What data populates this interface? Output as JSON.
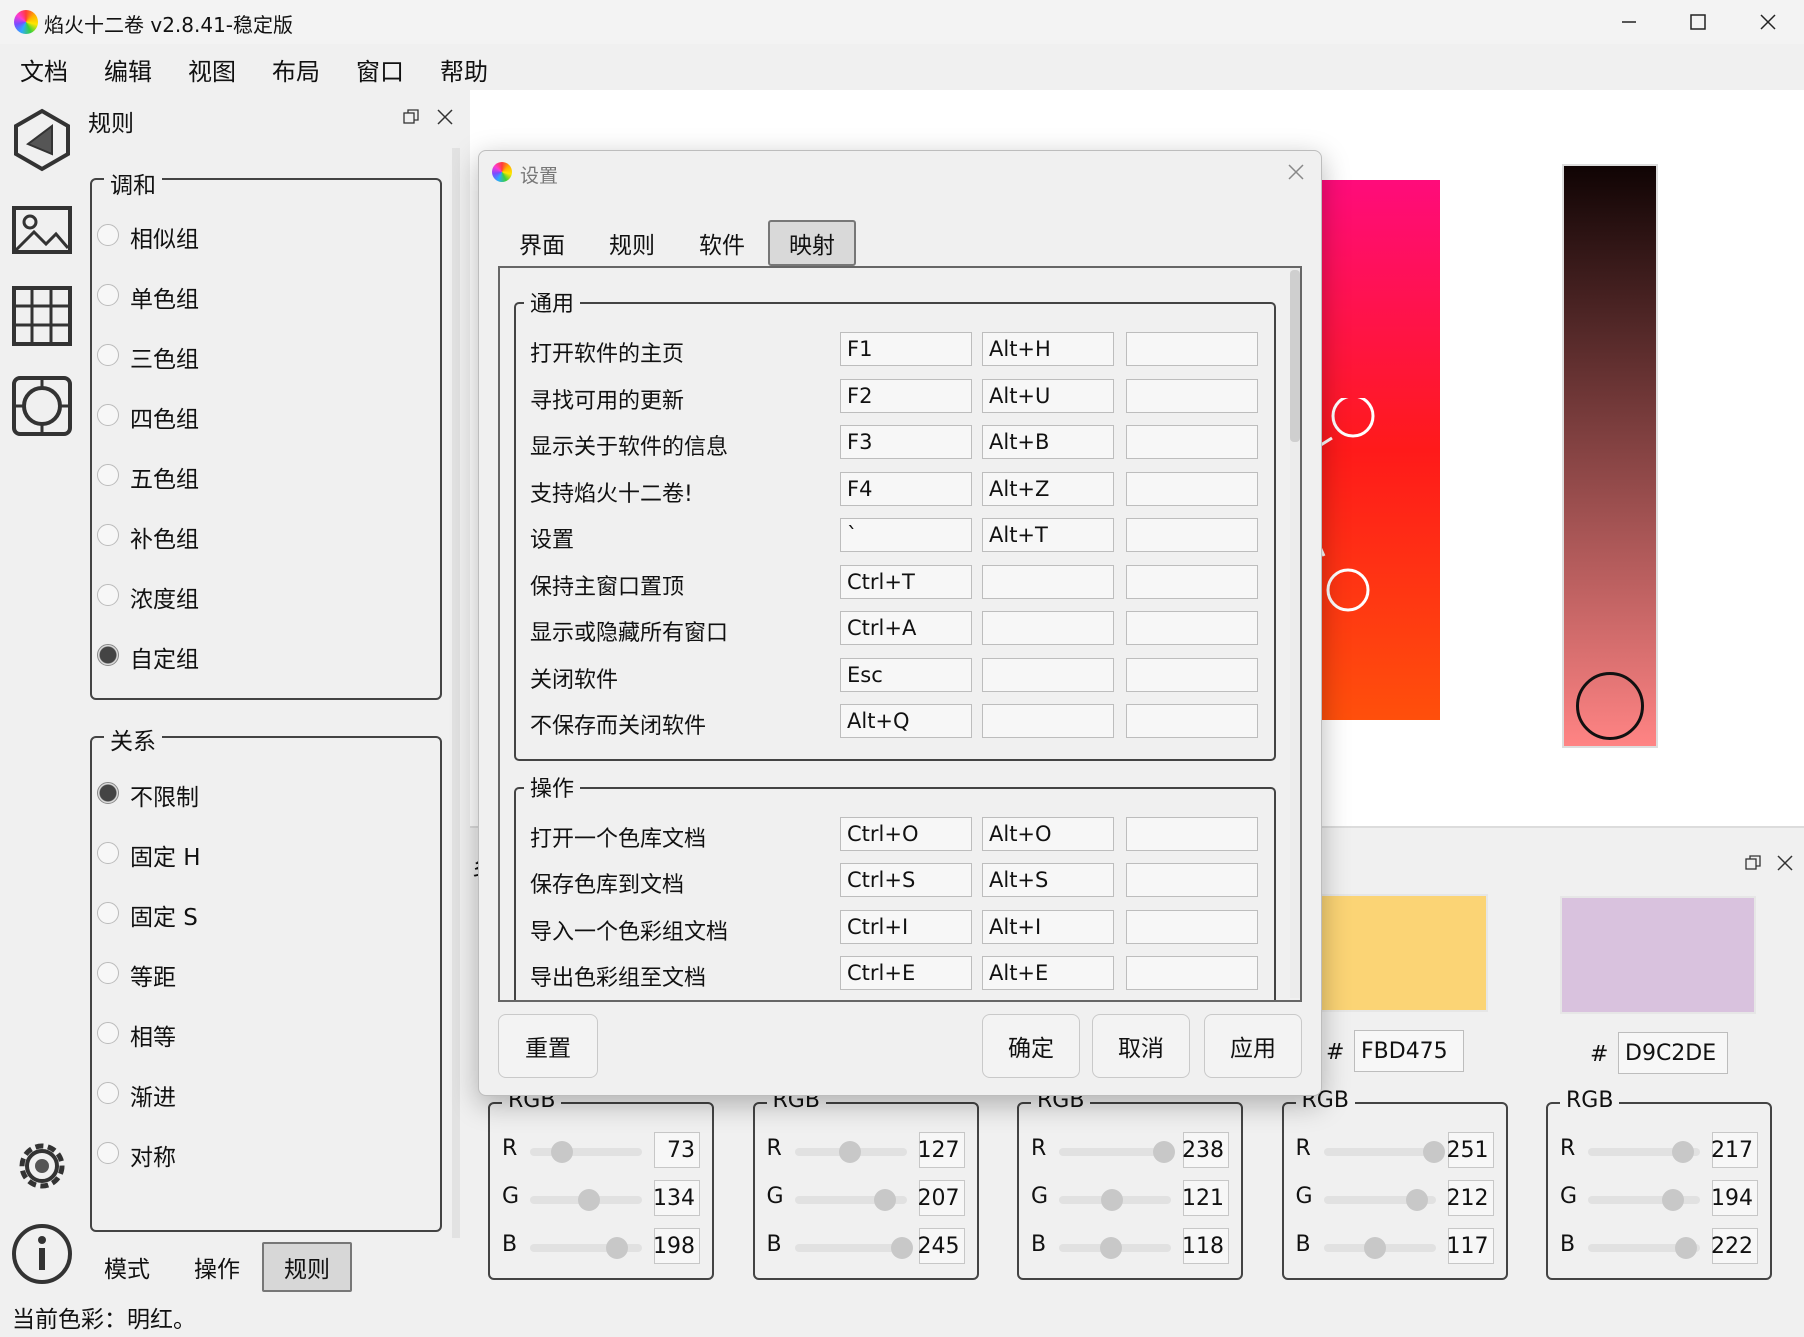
{
  "window": {
    "title": "焰火十二卷 v2.8.41-稳定版",
    "minimize_icon": "minimize-icon",
    "maximize_icon": "maximize-icon",
    "close_icon": "close-icon"
  },
  "menu": [
    "文档",
    "编辑",
    "视图",
    "布局",
    "窗口",
    "帮助"
  ],
  "rules_panel": {
    "title": "规则",
    "harmony_group": {
      "title": "调和",
      "options": [
        "相似组",
        "单色组",
        "三色组",
        "四色组",
        "五色组",
        "补色组",
        "浓度组",
        "自定组"
      ],
      "selected": "自定组"
    },
    "relation_group": {
      "title": "关系",
      "options": [
        "不限制",
        "固定 H",
        "固定 S",
        "等距",
        "相等",
        "渐进",
        "对称"
      ],
      "selected": "不限制"
    },
    "bottom_tabs": [
      "模式",
      "操作",
      "规则"
    ],
    "active_tab": "规则"
  },
  "status_bar": "当前色彩：明红。",
  "dialog": {
    "title": "设置",
    "tabs": [
      "界面",
      "规则",
      "软件",
      "映射"
    ],
    "active_tab": "映射",
    "sections": [
      {
        "title": "通用",
        "rows": [
          {
            "label": "打开软件的主页",
            "keys": [
              "F1",
              "Alt+H",
              ""
            ]
          },
          {
            "label": "寻找可用的更新",
            "keys": [
              "F2",
              "Alt+U",
              ""
            ]
          },
          {
            "label": "显示关于软件的信息",
            "keys": [
              "F3",
              "Alt+B",
              ""
            ]
          },
          {
            "label": "支持焰火十二卷!",
            "keys": [
              "F4",
              "Alt+Z",
              ""
            ]
          },
          {
            "label": "设置",
            "keys": [
              "`",
              "Alt+T",
              ""
            ]
          },
          {
            "label": "保持主窗口置顶",
            "keys": [
              "Ctrl+T",
              "",
              ""
            ]
          },
          {
            "label": "显示或隐藏所有窗口",
            "keys": [
              "Ctrl+A",
              "",
              ""
            ]
          },
          {
            "label": "关闭软件",
            "keys": [
              "Esc",
              "",
              ""
            ]
          },
          {
            "label": "不保存而关闭软件",
            "keys": [
              "Alt+Q",
              "",
              ""
            ]
          }
        ]
      },
      {
        "title": "操作",
        "rows": [
          {
            "label": "打开一个色库文档",
            "keys": [
              "Ctrl+O",
              "Alt+O",
              ""
            ]
          },
          {
            "label": "保存色库到文档",
            "keys": [
              "Ctrl+S",
              "Alt+S",
              ""
            ]
          },
          {
            "label": "导入一个色彩组文档",
            "keys": [
              "Ctrl+I",
              "Alt+I",
              ""
            ]
          },
          {
            "label": "导出色彩组至文档",
            "keys": [
              "Ctrl+E",
              "Alt+E",
              ""
            ]
          }
        ]
      }
    ],
    "buttons": {
      "reset": "重置",
      "ok": "确定",
      "cancel": "取消",
      "apply": "应用"
    }
  },
  "swatches": [
    {
      "hex": "FBD475",
      "color": "#fbd475"
    },
    {
      "hex": "D9C2DE",
      "color": "#d9c2de"
    }
  ],
  "hash_symbol": "#",
  "rgb_panels": [
    {
      "title": "RGB",
      "R": 73,
      "G": 134,
      "B": 198
    },
    {
      "title": "RGB",
      "R": 127,
      "G": 207,
      "B": 245
    },
    {
      "title": "RGB",
      "R": 238,
      "G": 121,
      "B": 118
    },
    {
      "title": "RGB",
      "R": 251,
      "G": 212,
      "B": 117
    },
    {
      "title": "RGB",
      "R": 217,
      "G": 194,
      "B": 222
    }
  ],
  "channel_labels": [
    "R",
    "G",
    "B"
  ],
  "colors": {
    "wheel_magenta": "#ff00c8",
    "wheel_red": "#ff1a1a",
    "wheel_orange": "#ff7a00",
    "strip_top": "#100404",
    "strip_bottom": "#ff8484"
  },
  "icons": {
    "tools": [
      "triangle-rule-icon",
      "image-icon",
      "grid-icon",
      "circle-quad-icon",
      "settings-gear-icon",
      "info-icon"
    ]
  },
  "cut_letter": "乡"
}
